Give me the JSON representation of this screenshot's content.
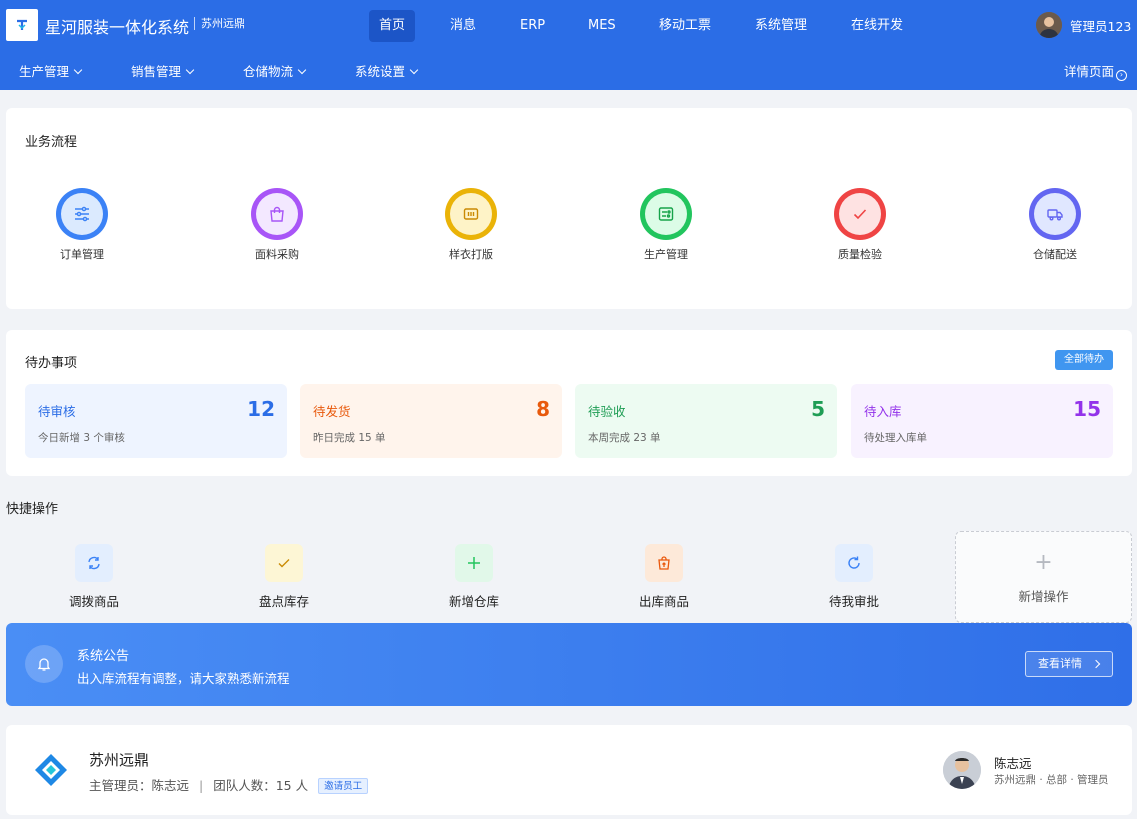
{
  "app": {
    "title": "星河服装一体化系统",
    "subtitle": "苏州远鼎"
  },
  "nav": {
    "tabs": [
      {
        "label": "首页"
      },
      {
        "label": "消息"
      },
      {
        "label": "ERP"
      },
      {
        "label": "MES"
      },
      {
        "label": "移动工票"
      },
      {
        "label": "系统管理"
      },
      {
        "label": "在线开发"
      }
    ],
    "active_tab": "首页",
    "user": "管理员123"
  },
  "subnav": {
    "items": [
      {
        "label": "生产管理"
      },
      {
        "label": "销售管理"
      },
      {
        "label": "仓储物流"
      },
      {
        "label": "系统设置"
      }
    ],
    "detail_link": "详情页面"
  },
  "flow": {
    "title": "业务流程",
    "items": [
      {
        "label": "订单管理",
        "icon": "sliders-icon",
        "color": "#3b82f6"
      },
      {
        "label": "面料采购",
        "icon": "shopping-bag-icon",
        "color": "#a855f7"
      },
      {
        "label": "样衣打版",
        "icon": "pattern-icon",
        "color": "#eab308"
      },
      {
        "label": "生产管理",
        "icon": "production-icon",
        "color": "#22c55e"
      },
      {
        "label": "质量检验",
        "icon": "check-icon",
        "color": "#ef4444"
      },
      {
        "label": "仓储配送",
        "icon": "truck-icon",
        "color": "#6366f1"
      }
    ]
  },
  "todo": {
    "title": "待办事项",
    "all_button": "全部待办",
    "items": [
      {
        "label": "待审核",
        "count": "12",
        "sub": "今日新增 3 个审核",
        "color": "#2b6de6",
        "bg": "#eef4ff"
      },
      {
        "label": "待发货",
        "count": "8",
        "sub": "昨日完成 15 单",
        "color": "#e8590c",
        "bg": "#fff4ec"
      },
      {
        "label": "待验收",
        "count": "5",
        "sub": "本周完成 23 单",
        "color": "#1f9d55",
        "bg": "#edfbf2"
      },
      {
        "label": "待入库",
        "count": "15",
        "sub": "待处理入库单",
        "color": "#9333ea",
        "bg": "#f8f2ff"
      }
    ]
  },
  "quick": {
    "title": "快捷操作",
    "items": [
      {
        "label": "调拨商品",
        "icon": "refresh-icon",
        "color": "#3b82f6",
        "bg": "#e3eefe"
      },
      {
        "label": "盘点库存",
        "icon": "check-icon",
        "color": "#ca8a04",
        "bg": "#fdf6d5"
      },
      {
        "label": "新增仓库",
        "icon": "plus-icon",
        "color": "#22c55e",
        "bg": "#e1f8e9"
      },
      {
        "label": "出库商品",
        "icon": "bag-out-icon",
        "color": "#ea580c",
        "bg": "#fde9d9"
      },
      {
        "label": "待我审批",
        "icon": "rotate-icon",
        "color": "#3b82f6",
        "bg": "#e3eefe"
      }
    ],
    "add_label": "新增操作"
  },
  "notice": {
    "title": "系统公告",
    "text": "出入库流程有调整，请大家熟悉新流程",
    "button": "查看详情"
  },
  "team": {
    "name": "苏州远鼎",
    "admin_label": "主管理员：陈志远",
    "size_label": "团队人数：15 人",
    "invite": "邀请员工",
    "person": {
      "name": "陈志远",
      "sub": "苏州远鼎 · 总部 · 管理员"
    }
  }
}
